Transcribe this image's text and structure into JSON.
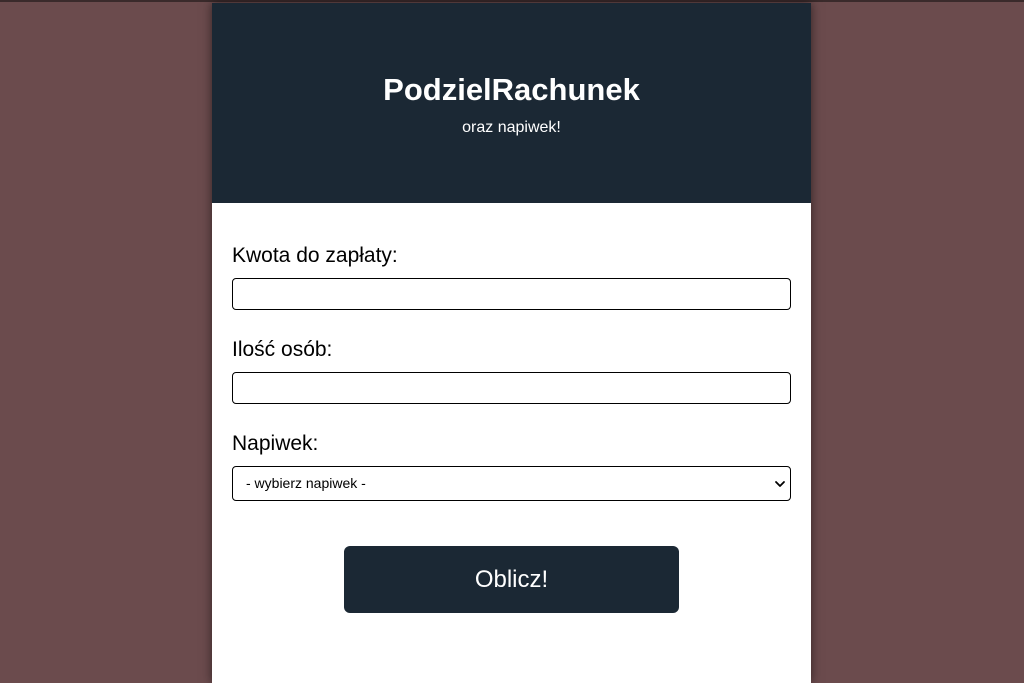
{
  "header": {
    "title": "PodzielRachunek",
    "subtitle": "oraz napiwek!"
  },
  "form": {
    "amount_label": "Kwota do zapłaty:",
    "amount_value": "",
    "people_label": "Ilość osób:",
    "people_value": "",
    "tip_label": "Napiwek:",
    "tip_selected": "- wybierz napiwek -"
  },
  "submit_label": "Oblicz!",
  "colors": {
    "background": "#6b4b4d",
    "accent": "#1b2834"
  }
}
